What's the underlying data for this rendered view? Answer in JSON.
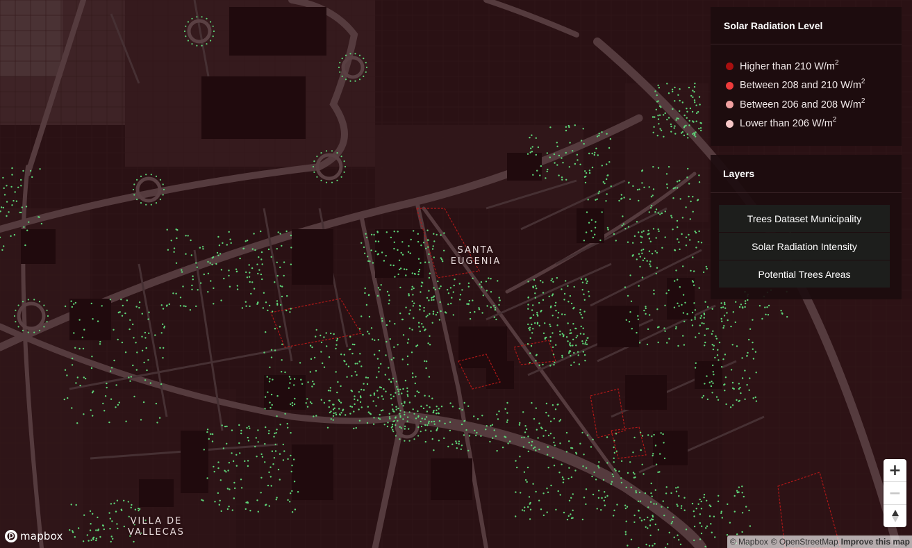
{
  "map": {
    "places": {
      "santa_line1": "SANTA",
      "santa_line2": "EUGENIA",
      "villa_line1": "VILLA DE",
      "villa_line2": "VALLECAS"
    },
    "tree_color": "#5fd87a",
    "background_color": "#2a1114"
  },
  "legend": {
    "title": "Solar Radiation Level",
    "unit_superscript": "2",
    "items": [
      {
        "label": "Higher than 210 W/m",
        "color": "#a80f0f"
      },
      {
        "label": "Between 208 and 210 W/m",
        "color": "#ee3b3b"
      },
      {
        "label": "Between 206 and 208 W/m",
        "color": "#f1a0a0"
      },
      {
        "label": "Lower than 206 W/m",
        "color": "#f7c7c7"
      }
    ]
  },
  "layers": {
    "title": "Layers",
    "buttons": [
      "Trees Dataset Municipality",
      "Solar Radiation Intensity",
      "Potential Trees Areas"
    ]
  },
  "controls": {
    "zoom_in": "+",
    "zoom_out": "−",
    "compass": "north-arrow-icon"
  },
  "branding": {
    "logo_text": "mapbox"
  },
  "attribution": {
    "mapbox": "© Mapbox",
    "osm": "© OpenStreetMap",
    "improve": "Improve this map"
  }
}
